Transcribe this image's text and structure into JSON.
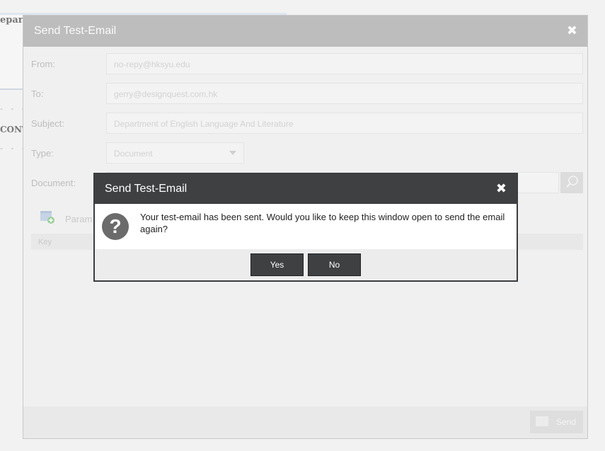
{
  "background": {
    "text_depart": "epart",
    "text_cont": "CONT"
  },
  "outer_dialog": {
    "title": "Send Test-Email",
    "close_glyph": "✖",
    "fields": [
      {
        "label": "From:",
        "value": "no-repy@hksyu.edu"
      },
      {
        "label": "To:",
        "value": "gerry@designquest.com.hk"
      },
      {
        "label": "Subject:",
        "value": "Department of English Language And Literature"
      },
      {
        "label": "Type:",
        "value": "Document"
      },
      {
        "label": "Document:",
        "value": ""
      }
    ],
    "params_label": "Param",
    "key_header": "Key",
    "send_label": "Send"
  },
  "inner_dialog": {
    "title": "Send Test-Email",
    "close_glyph": "✖",
    "icon_glyph": "?",
    "message": "Your test-email has been sent. Would you like to keep this window open to send the email again?",
    "yes_label": "Yes",
    "no_label": "No"
  },
  "colors": {
    "inner_titlebar": "#3e4042",
    "button": "#3e4042",
    "outer_titlebar": "#bdbdbd"
  }
}
